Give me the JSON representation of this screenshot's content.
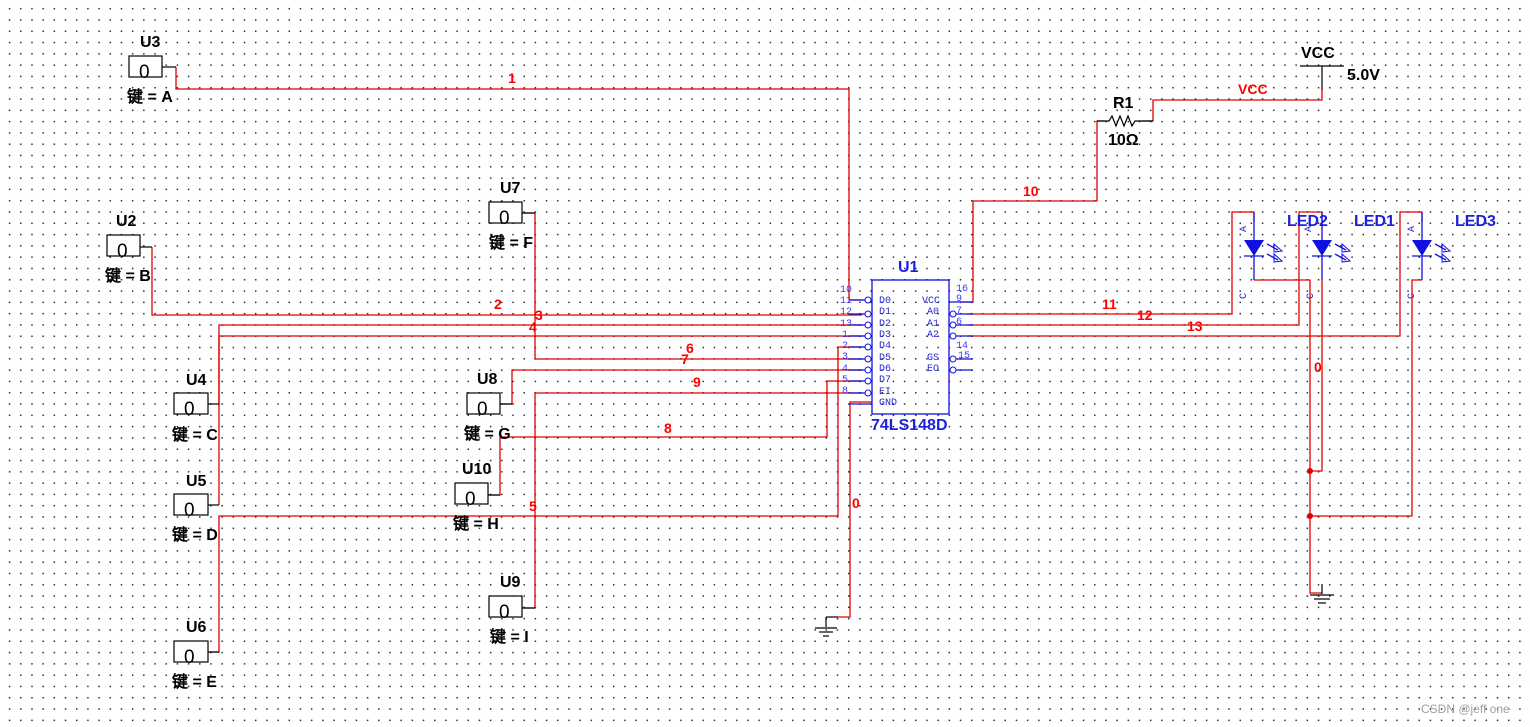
{
  "schematic": {
    "switches": [
      {
        "ref": "U3",
        "value": "0",
        "key_label": "键 = A"
      },
      {
        "ref": "U2",
        "value": "0",
        "key_label": "键 = B"
      },
      {
        "ref": "U4",
        "value": "0",
        "key_label": "键 = C"
      },
      {
        "ref": "U5",
        "value": "0",
        "key_label": "键 = D"
      },
      {
        "ref": "U6",
        "value": "0",
        "key_label": "键 = E"
      },
      {
        "ref": "U7",
        "value": "0",
        "key_label": "键 = F"
      },
      {
        "ref": "U8",
        "value": "0",
        "key_label": "键 = G"
      },
      {
        "ref": "U10",
        "value": "0",
        "key_label": "键 = H"
      },
      {
        "ref": "U9",
        "value": "0",
        "key_label": "键 = I"
      }
    ],
    "ic": {
      "ref": "U1",
      "part": "74LS148D",
      "left_pins": [
        {
          "num": "10",
          "name": ""
        },
        {
          "num": "11",
          "name": "D0"
        },
        {
          "num": "12",
          "name": "D1"
        },
        {
          "num": "13",
          "name": "D2"
        },
        {
          "num": "1",
          "name": "D3"
        },
        {
          "num": "2",
          "name": "D4"
        },
        {
          "num": "3",
          "name": "D5"
        },
        {
          "num": "4",
          "name": "D6"
        },
        {
          "num": "5",
          "name": "D7"
        },
        {
          "num": "8",
          "name": "EI"
        },
        {
          "num": "",
          "name": "GND"
        }
      ],
      "right_pins": [
        {
          "num": "16",
          "name": ""
        },
        {
          "num": "9",
          "name": "VCC"
        },
        {
          "num": "7",
          "name": "A0"
        },
        {
          "num": "6",
          "name": "A1"
        },
        {
          "num": "",
          "name": "A2"
        },
        {
          "num": "14",
          "name": ""
        },
        {
          "num": "15",
          "name": "GS"
        },
        {
          "num": "",
          "name": "EO"
        }
      ]
    },
    "resistor": {
      "ref": "R1",
      "value": "10Ω"
    },
    "power": {
      "ref": "VCC",
      "voltage": "5.0V",
      "net_label": "VCC"
    },
    "leds": [
      {
        "ref": "LED2",
        "anode": "A",
        "cathode": "C"
      },
      {
        "ref": "LED1",
        "anode": "A",
        "cathode": "C"
      },
      {
        "ref": "LED3",
        "anode": "A",
        "cathode": "C"
      }
    ],
    "nets": {
      "n1": "1",
      "n2": "2",
      "n3": "3",
      "n4": "4",
      "n5": "5",
      "n6": "6",
      "n7": "7",
      "n8": "8",
      "n9": "9",
      "n10": "10",
      "n11": "11",
      "n12": "12",
      "n13": "13",
      "gnd_left": "0",
      "gnd_right": "0"
    },
    "colors": {
      "wire": "#e00000",
      "component_blue": "#1010e0",
      "component_black": "#000000",
      "grid_dot": "#2b2b2b",
      "background": "#ffffff"
    }
  },
  "watermark": "CSDN @jeff one"
}
